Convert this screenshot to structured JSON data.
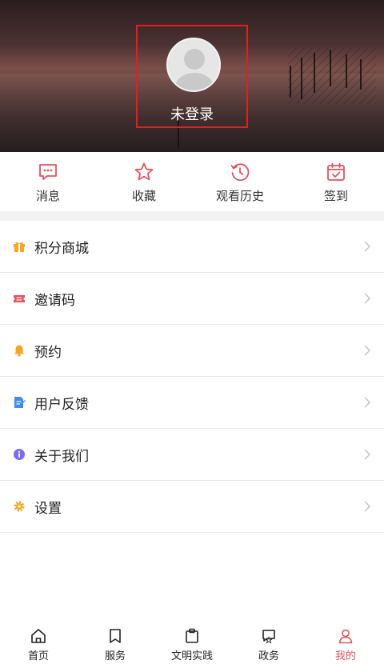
{
  "header": {
    "login_text": "未登录"
  },
  "quick_actions": [
    {
      "label": "消息",
      "icon": "message-icon"
    },
    {
      "label": "收藏",
      "icon": "star-icon"
    },
    {
      "label": "观看历史",
      "icon": "history-icon"
    },
    {
      "label": "签到",
      "icon": "calendar-check-icon"
    }
  ],
  "menu": [
    {
      "label": "积分商城",
      "icon": "gift-icon",
      "color": "#f5a623"
    },
    {
      "label": "邀请码",
      "icon": "ticket-icon",
      "color": "#e8505b"
    },
    {
      "label": "预约",
      "icon": "bell-icon",
      "color": "#f5a623"
    },
    {
      "label": "用户反馈",
      "icon": "feedback-icon",
      "color": "#3d8ef0"
    },
    {
      "label": "关于我们",
      "icon": "info-icon",
      "color": "#7b6cf0"
    },
    {
      "label": "设置",
      "icon": "gear-icon",
      "color": "#f5a623"
    }
  ],
  "tabbar": [
    {
      "label": "首页",
      "icon": "home-icon"
    },
    {
      "label": "服务",
      "icon": "bookmark-icon"
    },
    {
      "label": "文明实践",
      "icon": "clipboard-icon"
    },
    {
      "label": "政务",
      "icon": "flag-icon"
    },
    {
      "label": "我的",
      "icon": "user-icon",
      "active": true
    }
  ],
  "colors": {
    "accent": "#e8505b",
    "highlight_border": "#e02020"
  }
}
